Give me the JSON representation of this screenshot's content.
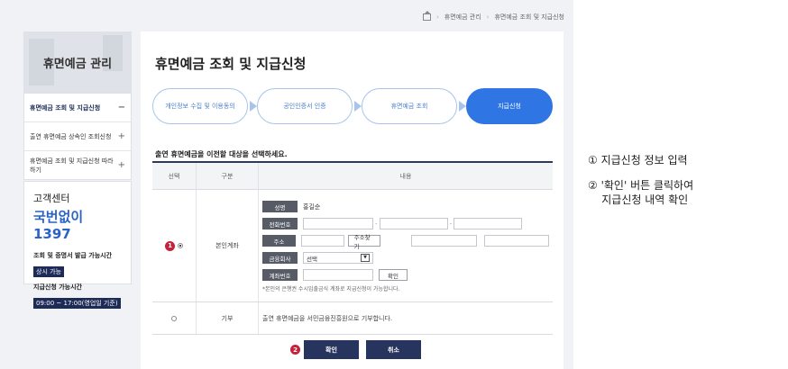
{
  "breadcrumb": [
    "휴면예금 관리",
    "휴면예금 조회 및 지급신청"
  ],
  "sidebar": {
    "title": "휴면예금 관리",
    "items": [
      {
        "label": "휴면예금 조회 및 지급신청",
        "mark": "−"
      },
      {
        "label": "출연 휴면예금 상속인 조회신청",
        "mark": "+"
      },
      {
        "label": "휴면예금 조회 및 지급신청 따라하기",
        "mark": "+"
      }
    ],
    "customer_center": {
      "title": "고객센터",
      "phone": "국번없이 1397",
      "hours1_label": "조회 및 증명서 발급 가능시간",
      "hours1_value": "상시 가능",
      "hours2_label": "지급신청 가능시간",
      "hours2_value": "09:00 ~ 17:00(영업일 기준)"
    }
  },
  "main": {
    "title": "휴면예금 조회 및 지급신청",
    "steps": [
      "개인정보 수집 및 이용동의",
      "공인인증서 인증",
      "휴면예금 조회",
      "지급신청"
    ],
    "instruction": "출연 휴면예금을 이전할 대상을 선택하세요.",
    "table": {
      "headers": [
        "선택",
        "구분",
        "내용"
      ],
      "row1": {
        "badge": "1",
        "type": "본인계좌",
        "fields": {
          "name_label": "성명",
          "name_value": "홍길순",
          "phone_label": "전화번호",
          "address_label": "주소",
          "address_button": "주소찾기",
          "bank_label": "금융회사",
          "bank_select": "선택",
          "account_label": "계좌번호",
          "account_button": "확인"
        },
        "note": "*본인의 은행권 수시입출금식 계좌로 지급신청이 가능합니다."
      },
      "row2": {
        "type": "기부",
        "content": "출연 휴면예금을 서민금융진흥원으로 기부합니다."
      }
    },
    "buttons": {
      "badge": "2",
      "confirm": "확인",
      "cancel": "취소"
    }
  },
  "annotations": {
    "line1": "① 지급신청 정보 입력",
    "line2": "② '확인' 버튼 클릭하여",
    "line3": "    지급신청 내역 확인"
  }
}
